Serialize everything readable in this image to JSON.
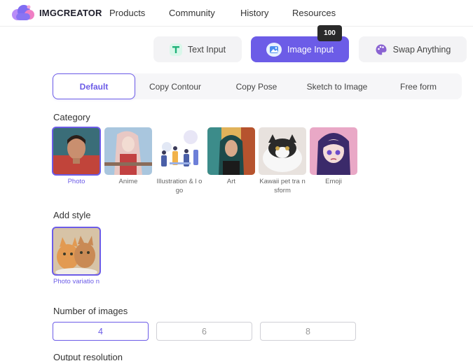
{
  "header": {
    "logo_text": "IMGCREATOR",
    "nav": [
      "Products",
      "Community",
      "History",
      "Resources"
    ]
  },
  "modes": {
    "text_input": "Text Input",
    "image_input": "Image Input",
    "swap_anything": "Swap Anything",
    "tooltip": "100"
  },
  "subtabs": [
    "Default",
    "Copy Contour",
    "Copy Pose",
    "Sketch to Image",
    "Free form"
  ],
  "category": {
    "label": "Category",
    "items": [
      {
        "label": "Photo",
        "selected": true
      },
      {
        "label": "Anime",
        "selected": false
      },
      {
        "label": "Illustration & l ogo",
        "selected": false
      },
      {
        "label": "Art",
        "selected": false
      },
      {
        "label": "Kawaii pet tra nsform",
        "selected": false
      },
      {
        "label": "Emoji",
        "selected": false
      }
    ]
  },
  "style": {
    "label": "Add style",
    "items": [
      {
        "label": "Photo variatio n",
        "selected": true
      }
    ]
  },
  "images": {
    "label": "Number of images",
    "options": [
      "4",
      "6",
      "8"
    ],
    "selected": "4"
  },
  "resolution": {
    "label": "Output resolution"
  },
  "colors": {
    "accent": "#6c5ce7",
    "tab_bg": "#f3f3f5"
  }
}
